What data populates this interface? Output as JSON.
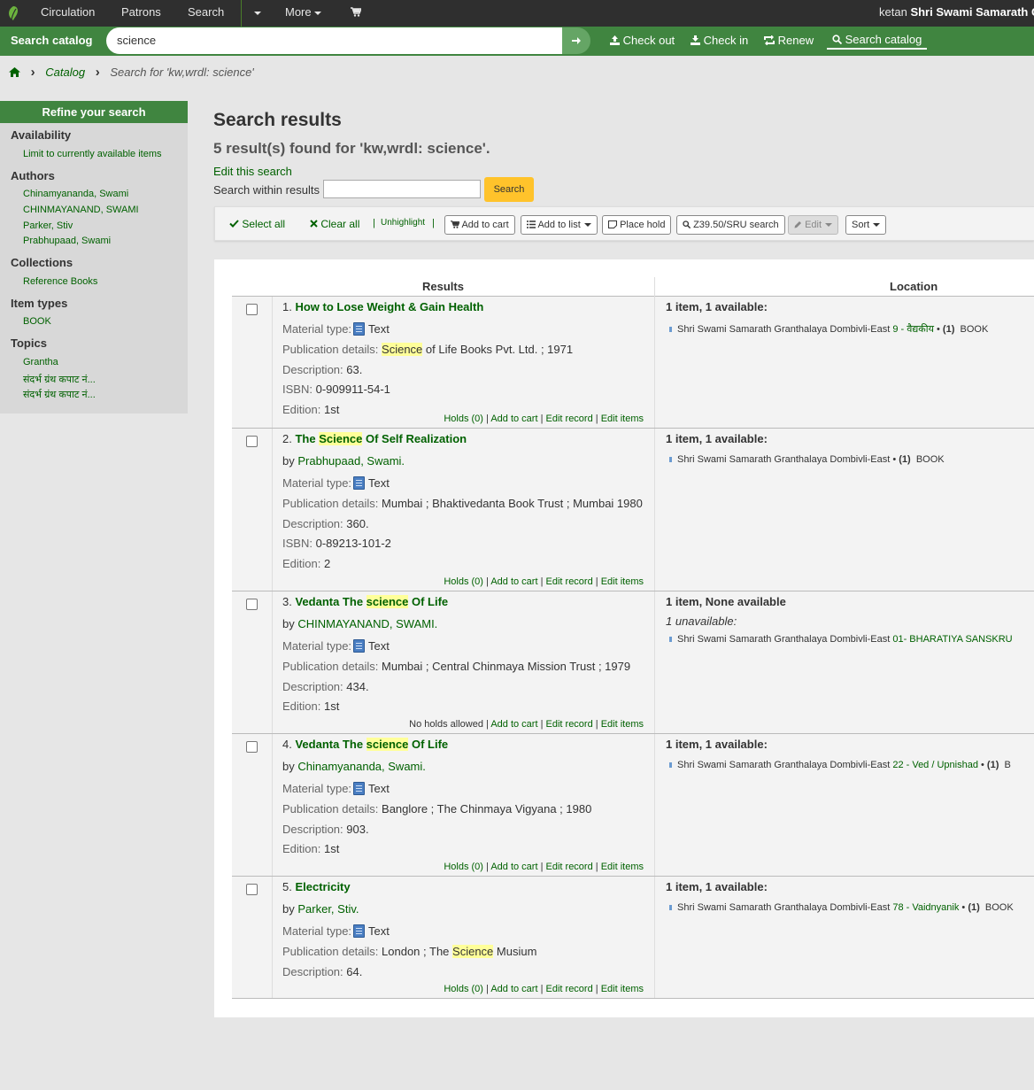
{
  "nav": {
    "items": [
      "Circulation",
      "Patrons",
      "Search",
      "More"
    ],
    "user_prefix": "ketan",
    "library": "Shri Swami Samarath G"
  },
  "searchbar": {
    "label": "Search catalog",
    "query": "science",
    "checkout": "Check out",
    "checkin": "Check in",
    "renew": "Renew",
    "search_catalog": "Search catalog"
  },
  "breadcrumb": {
    "catalog": "Catalog",
    "current": "Search for 'kw,wrdl: science'"
  },
  "facets": {
    "heading": "Refine your search",
    "availability": "Availability",
    "availability_limit": "Limit to currently available items",
    "authors": "Authors",
    "author_items": [
      "Chinamyananda, Swami",
      "CHINMAYANAND, SWAMI",
      "Parker, Stiv",
      "Prabhupaad, Swami"
    ],
    "collections": "Collections",
    "collection_items": [
      "Reference Books"
    ],
    "item_types": "Item types",
    "item_type_items": [
      "BOOK"
    ],
    "topics": "Topics",
    "topic_items": [
      "Grantha",
      "संदर्भ ग्रंथ कपाट नं...",
      "संदर्भ ग्रंथ कपाट नं..."
    ]
  },
  "main": {
    "title": "Search results",
    "count": "5 result(s) found for 'kw,wrdl: science'.",
    "edit_search": "Edit this search",
    "within_label": "Search within results",
    "within_button": "Search"
  },
  "toolbar": {
    "select_all": "Select all",
    "clear_all": "Clear all",
    "unhighlight": "Unhighlight",
    "add_to_cart": "Add to cart",
    "add_to_list": "Add to list",
    "place_hold": "Place hold",
    "z3950": "Z39.50/SRU search",
    "edit": "Edit",
    "sort": "Sort"
  },
  "table": {
    "col_results": "Results",
    "col_location": "Location"
  },
  "labels": {
    "by": "by",
    "material_type": "Material type:",
    "publication": "Publication details:",
    "description": "Description:",
    "isbn": "ISBN:",
    "edition": "Edition:",
    "holds": "Holds (0)",
    "no_holds": "No holds allowed",
    "add_to_cart": "Add to cart",
    "edit_record": "Edit record",
    "edit_items": "Edit items",
    "text": "Text",
    "library": "Shri Swami Samarath Granthalaya Dombivli-East"
  },
  "results": [
    {
      "num": "1.",
      "title_pre": "How to Lose Weight & Gain Health",
      "title_hl": "",
      "title_post": "",
      "author": "",
      "pub_hl": "Science",
      "pub": " of Life Books Pvt. Ltd. ; 1971",
      "description": "63.",
      "isbn": "0-909911-54-1",
      "edition": "1st",
      "avail": "1 item, 1 available:",
      "unavail": "",
      "shelf": "9 - वैद्यकीय",
      "copies": "(1)",
      "itype": "BOOK"
    },
    {
      "num": "2.",
      "title_pre": "The ",
      "title_hl": "Science",
      "title_post": " Of Self Realization",
      "author": "Prabhupaad, Swami.",
      "pub_hl": "",
      "pub": "Mumbai ; Bhaktivedanta Book Trust ; Mumbai 1980",
      "description": "360.",
      "isbn": "0-89213-101-2",
      "edition": "2",
      "avail": "1 item, 1 available:",
      "unavail": "",
      "shelf": "",
      "copies": "(1)",
      "itype": "BOOK"
    },
    {
      "num": "3.",
      "title_pre": "Vedanta The ",
      "title_hl": "science",
      "title_post": " Of Life",
      "author": "CHINMAYANAND, SWAMI.",
      "pub_hl": "",
      "pub": "Mumbai ; Central Chinmaya Mission Trust ; 1979",
      "description": "434.",
      "isbn": "",
      "edition": "1st",
      "avail": "1 item, None available",
      "unavail": "1 unavailable:",
      "shelf": "01- BHARATIYA SANSKRU",
      "copies": "",
      "itype": ""
    },
    {
      "num": "4.",
      "title_pre": "Vedanta The ",
      "title_hl": "science",
      "title_post": " Of Life",
      "author": "Chinamyananda, Swami.",
      "pub_hl": "",
      "pub": "Banglore ; The Chinmaya Vigyana ; 1980",
      "description": "903.",
      "isbn": "",
      "edition": "1st",
      "avail": "1 item, 1 available:",
      "unavail": "",
      "shelf": "22 - Ved / Upnishad",
      "copies": "(1)",
      "itype": "B"
    },
    {
      "num": "5.",
      "title_pre": "Electricity",
      "title_hl": "",
      "title_post": "",
      "author": "Parker, Stiv.",
      "pub_hl": "",
      "pub": "London ; The ",
      "pub_hl2": "Science",
      "pub_post": " Musium",
      "description": "64.",
      "isbn": "",
      "edition": "",
      "avail": "1 item, 1 available:",
      "unavail": "",
      "shelf": "78 - Vaidnyanik",
      "copies": "(1)",
      "itype": "BOOK"
    }
  ],
  "colors": {
    "nav_bg": "#2f2f2f",
    "green": "#408540",
    "link": "#006100",
    "highlight": "#ffff99",
    "search_btn": "#ffc32b"
  }
}
